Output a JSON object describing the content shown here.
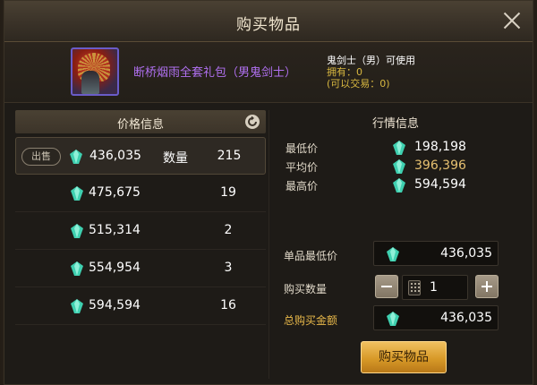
{
  "dialog": {
    "title": "购买物品"
  },
  "item": {
    "name": "断桥烟雨全套礼包（男鬼剑士）",
    "usable_by": "鬼剑士（男）可使用",
    "owned": "拥有：0",
    "tradeable": "(可以交易：0)"
  },
  "price_panel": {
    "header": "价格信息",
    "sell_tag": "出售",
    "quantity_label": "数量",
    "listings": [
      {
        "price": "436,035",
        "qty": "215"
      },
      {
        "price": "475,675",
        "qty": "19"
      },
      {
        "price": "515,314",
        "qty": "2"
      },
      {
        "price": "554,954",
        "qty": "3"
      },
      {
        "price": "594,594",
        "qty": "16"
      }
    ]
  },
  "market_panel": {
    "header": "行情信息",
    "min_label": "最低价",
    "min_value": "198,198",
    "avg_label": "平均价",
    "avg_value": "396,396",
    "max_label": "最高价",
    "max_value": "594,594"
  },
  "purchase": {
    "unit_min_label": "单品最低价",
    "unit_min_value": "436,035",
    "qty_label": "购买数量",
    "qty_value": "1",
    "total_label": "总购买金额",
    "total_value": "436,035",
    "buy_label": "购买物品"
  },
  "colors": {
    "item_name": "#b070f0",
    "avg_price": "#e6c070",
    "total_label": "#e8b84a",
    "buy_button": "#d89a28",
    "currency_gem": "#3fd0b0"
  },
  "icons": {
    "close": "close-icon",
    "refresh": "refresh-icon",
    "currency": "gem-icon",
    "keypad": "keypad-icon",
    "minus": "minus-icon",
    "plus": "plus-icon"
  }
}
